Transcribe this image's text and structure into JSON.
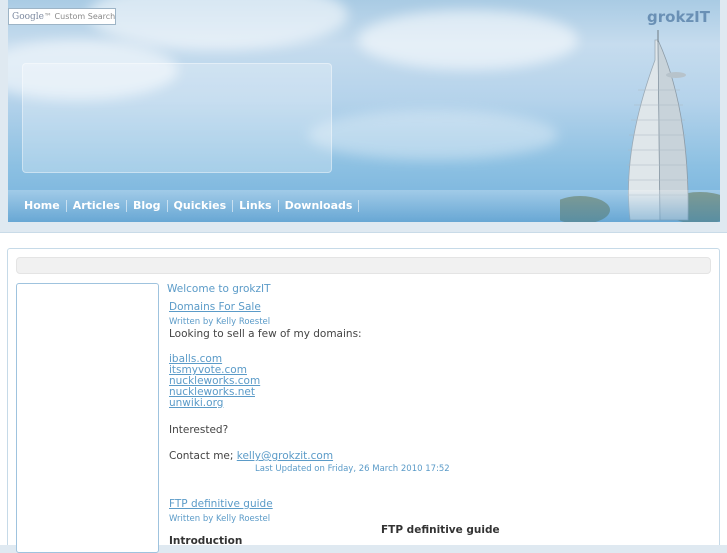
{
  "search": {
    "brand": "Google",
    "label": "Custom Search"
  },
  "site": {
    "title": "grokzIT"
  },
  "nav": {
    "items": [
      "Home",
      "Articles",
      "Blog",
      "Quickies",
      "Links",
      "Downloads"
    ]
  },
  "main": {
    "welcome": "Welcome to grokzIT",
    "article1": {
      "title": "Domains For Sale",
      "byline": "Written by Kelly Roestel",
      "intro": "Looking to sell a few of my domains:",
      "domains": [
        "iballs.com",
        "itsmyvote.com",
        "nuckleworks.com",
        "nuckleworks.net",
        "unwiki.org"
      ],
      "interested": "Interested?",
      "contact_label": "Contact me;",
      "contact_email": "kelly@grokzit.com",
      "updated": "Last Updated on Friday, 26 March 2010 17:52"
    },
    "article2": {
      "title": "FTP definitive guide",
      "byline": "Written by Kelly Roestel",
      "heading": "FTP definitive guide",
      "section": "Introduction"
    }
  }
}
